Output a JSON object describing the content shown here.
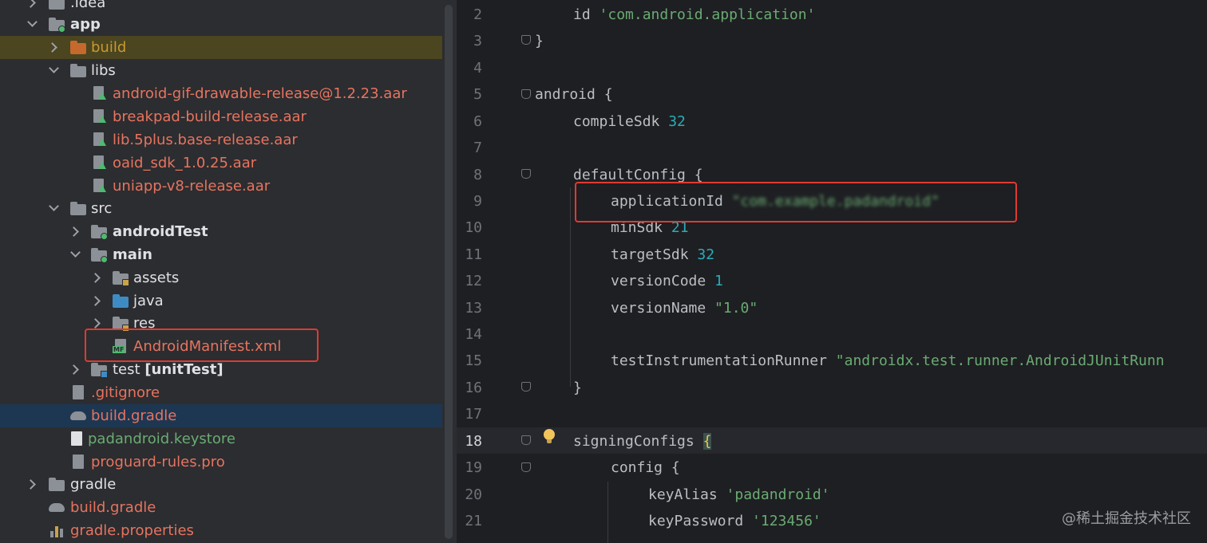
{
  "project_tree": {
    "items": [
      {
        "label": ".idea"
      },
      {
        "label": "app"
      },
      {
        "label": "build"
      },
      {
        "label": "libs"
      },
      {
        "label": "android-gif-drawable-release@1.2.23.aar"
      },
      {
        "label": "breakpad-build-release.aar"
      },
      {
        "label": "lib.5plus.base-release.aar"
      },
      {
        "label": "oaid_sdk_1.0.25.aar"
      },
      {
        "label": "uniapp-v8-release.aar"
      },
      {
        "label": "src"
      },
      {
        "label": "androidTest"
      },
      {
        "label": "main"
      },
      {
        "label": "assets"
      },
      {
        "label": "java"
      },
      {
        "label": "res"
      },
      {
        "label": "AndroidManifest.xml",
        "icon_badge": "MF"
      },
      {
        "label": "test",
        "suffix": "[unitTest]"
      },
      {
        "label": ".gitignore"
      },
      {
        "label": "build.gradle"
      },
      {
        "label": "padandroid.keystore"
      },
      {
        "label": "proguard-rules.pro"
      },
      {
        "label": "gradle"
      },
      {
        "label": "build.gradle"
      },
      {
        "label": "gradle.properties"
      }
    ]
  },
  "editor": {
    "current_line": "18",
    "lines": [
      {
        "num": "2",
        "parts": [
          "id ",
          "'com.android.application'"
        ]
      },
      {
        "num": "3",
        "parts": [
          "}"
        ]
      },
      {
        "num": "4",
        "parts": [
          ""
        ]
      },
      {
        "num": "5",
        "parts": [
          "android {"
        ]
      },
      {
        "num": "6",
        "parts": [
          "compileSdk ",
          "32"
        ]
      },
      {
        "num": "7",
        "parts": [
          ""
        ]
      },
      {
        "num": "8",
        "parts": [
          "defaultConfig {"
        ]
      },
      {
        "num": "9",
        "parts": [
          "applicationId ",
          "\"com.example.padandroid\""
        ]
      },
      {
        "num": "10",
        "parts": [
          "minSdk ",
          "21"
        ]
      },
      {
        "num": "11",
        "parts": [
          "targetSdk ",
          "32"
        ]
      },
      {
        "num": "12",
        "parts": [
          "versionCode ",
          "1"
        ]
      },
      {
        "num": "13",
        "parts": [
          "versionName ",
          "\"1.0\""
        ]
      },
      {
        "num": "14",
        "parts": [
          ""
        ]
      },
      {
        "num": "15",
        "parts": [
          "testInstrumentationRunner ",
          "\"androidx.test.runner.AndroidJUnitRunn"
        ]
      },
      {
        "num": "16",
        "parts": [
          "}"
        ]
      },
      {
        "num": "17",
        "parts": [
          ""
        ]
      },
      {
        "num": "18",
        "parts": [
          "signingConfigs ",
          "{"
        ]
      },
      {
        "num": "19",
        "parts": [
          "config {"
        ]
      },
      {
        "num": "20",
        "parts": [
          "keyAlias ",
          "'padandroid'"
        ]
      },
      {
        "num": "21",
        "parts": [
          "keyPassword ",
          "'123456'"
        ]
      }
    ]
  },
  "watermark": "@稀土掘金技术社区",
  "colors": {
    "annotation_box": "#e03a31",
    "string": "#6aab73",
    "number": "#2aacb8",
    "ignored_file": "#e8735f",
    "untracked_file": "#6aab73"
  }
}
